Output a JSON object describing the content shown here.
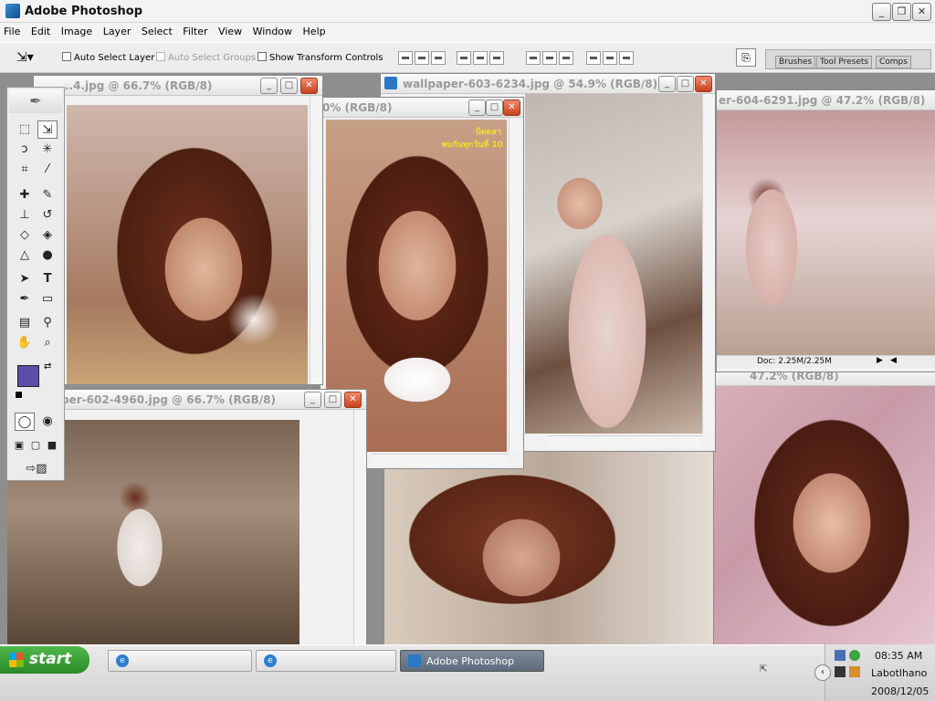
{
  "app": {
    "title": "Adobe Photoshop"
  },
  "menu": [
    "File",
    "Edit",
    "Image",
    "Layer",
    "Select",
    "Filter",
    "View",
    "Window",
    "Help"
  ],
  "options": {
    "auto_select_layer": "Auto Select Layer",
    "auto_select_groups": "Auto Select Groups",
    "show_transform_controls": "Show Transform Controls"
  },
  "palette_well": [
    "Brushes",
    "Tool Presets",
    "Comps"
  ],
  "documents": [
    {
      "title": "..4.jpg @ 66.7% (RGB/8)"
    },
    {
      "title": "wallpaper-603-6234.jpg @ 54.9% (RGB/8)"
    },
    {
      "title": "0% (RGB/8)"
    },
    {
      "title": "er-604-6291.jpg @ 47.2% (RGB/8)",
      "status": "Doc: 2.25M/2.25M"
    },
    {
      "title": "per-602-4960.jpg @ 66.7% (RGB/8)"
    },
    {
      "title": "47.2% (RGB/8)"
    }
  ],
  "image_overlay_text": {
    "line1": "บิดดลา",
    "line2": "พบกันทุกวันที่ 10"
  },
  "colors": {
    "foreground": "#5a4ea8",
    "background": "#ffffff"
  },
  "taskbar": {
    "start": "start",
    "tasks": [
      "",
      "",
      "Adobe Photoshop"
    ],
    "clock": {
      "time": "08:35 AM",
      "name": "Labotlhano",
      "date": "2008/12/05"
    }
  }
}
